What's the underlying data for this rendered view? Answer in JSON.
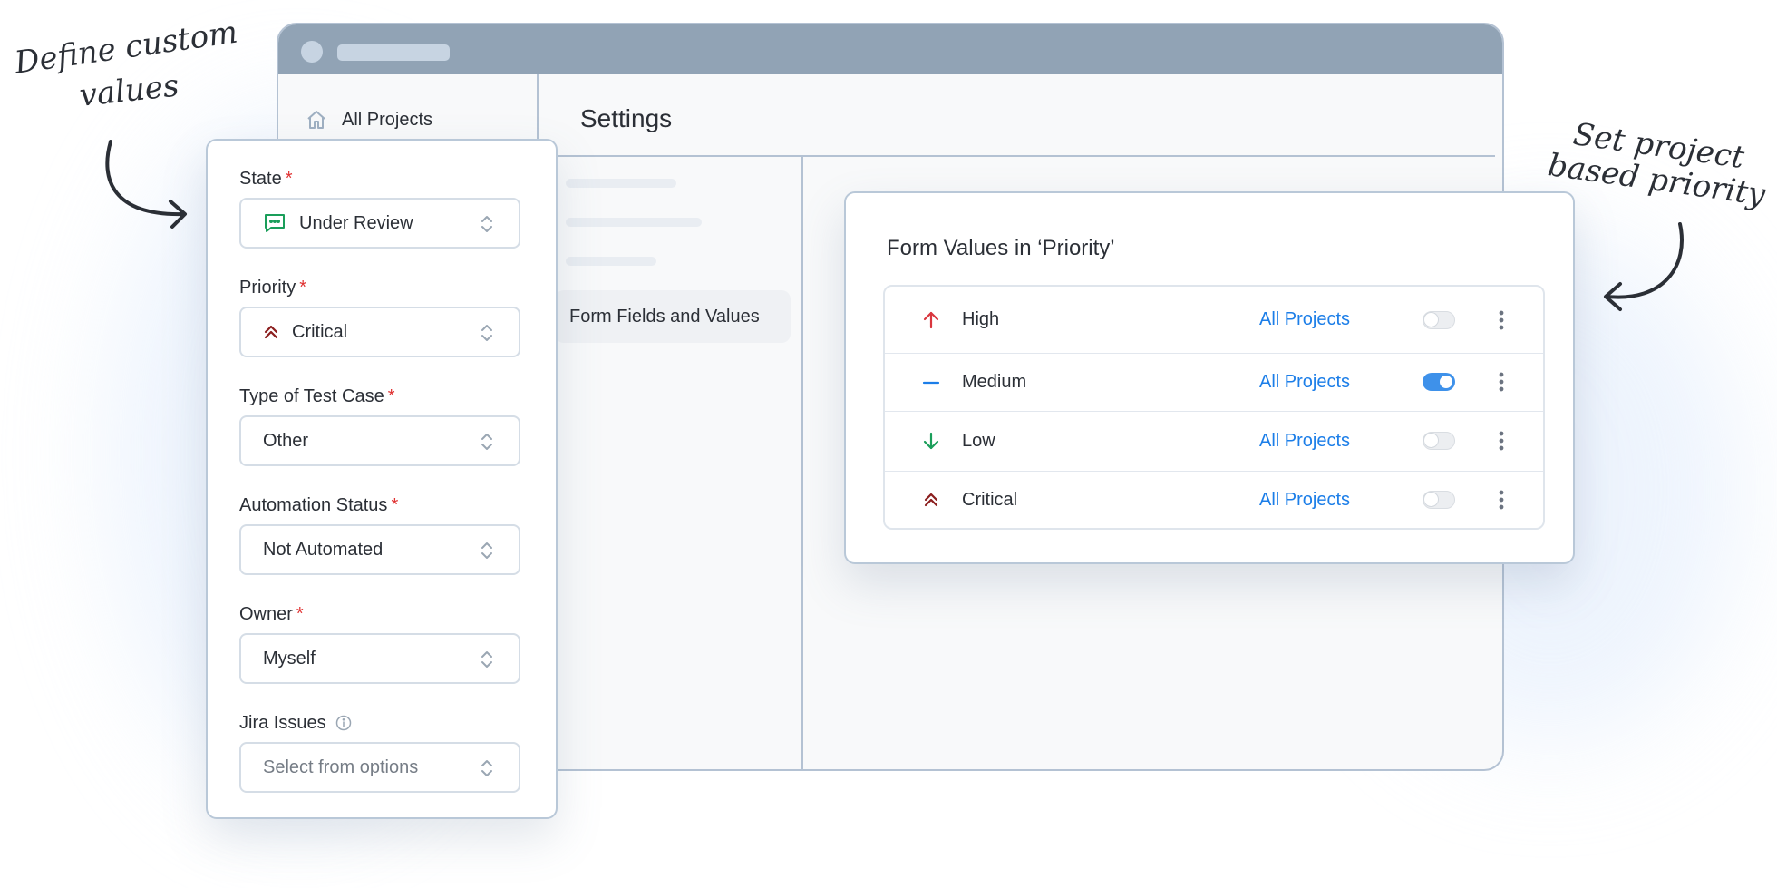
{
  "annotations": {
    "left_line1": "Define custom",
    "left_line2": "values",
    "right_line1": "Set project",
    "right_line2": "based priority"
  },
  "window": {
    "sidebar_item_label": "All Projects",
    "title": "Settings",
    "active_menu_item": "Form Fields and Values"
  },
  "form": {
    "fields": [
      {
        "label": "State",
        "required": true,
        "value": "Under Review",
        "icon": "comment-icon"
      },
      {
        "label": "Priority",
        "required": true,
        "value": "Critical",
        "icon": "double-chevron-up-icon"
      },
      {
        "label": "Type of Test Case",
        "required": true,
        "value": "Other"
      },
      {
        "label": "Automation Status",
        "required": true,
        "value": "Not Automated"
      },
      {
        "label": "Owner",
        "required": true,
        "value": "Myself"
      },
      {
        "label": "Jira Issues",
        "required": false,
        "placeholder": "Select from options",
        "icon": "info-icon"
      }
    ],
    "required_marker": "*"
  },
  "priority_panel": {
    "title": "Form Values in ‘Priority’",
    "rows": [
      {
        "name": "High",
        "scope": "All Projects",
        "enabled": false,
        "icon": "arrow-up-icon",
        "icon_color": "#d9363e"
      },
      {
        "name": "Medium",
        "scope": "All Projects",
        "enabled": true,
        "icon": "dash-icon",
        "icon_color": "#1c7ee8"
      },
      {
        "name": "Low",
        "scope": "All Projects",
        "enabled": false,
        "icon": "arrow-down-icon",
        "icon_color": "#1a9e5a"
      },
      {
        "name": "Critical",
        "scope": "All Projects",
        "enabled": false,
        "icon": "double-chevron-up-icon",
        "icon_color": "#8b1e1e"
      }
    ]
  },
  "colors": {
    "accent": "#1c7ee8",
    "required": "#e03131",
    "titlebar": "#91a3b5",
    "border": "#b4c2d3"
  }
}
